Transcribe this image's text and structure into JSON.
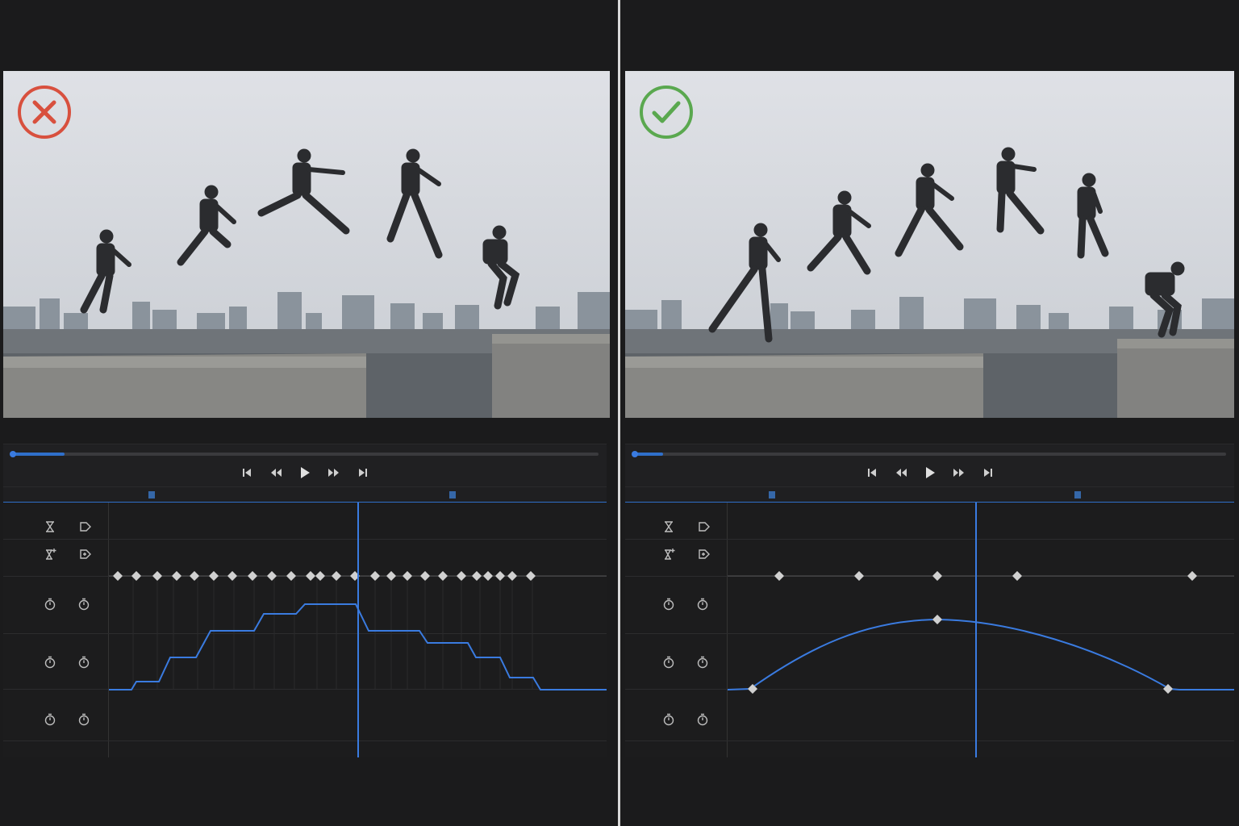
{
  "panels": [
    {
      "id": "left",
      "verdict": "incorrect",
      "verdict_icon": "x-circle-icon",
      "verdict_color": "#d8503e",
      "curve_style": "stepped",
      "playhead_position": 0.5,
      "playback_progress": 0.09
    },
    {
      "id": "right",
      "verdict": "correct",
      "verdict_icon": "check-circle-icon",
      "verdict_color": "#5aa84f",
      "curve_style": "smooth",
      "playhead_position": 0.49,
      "playback_progress": 0.05
    }
  ],
  "transport": {
    "buttons": [
      "skip-to-start-icon",
      "rewind-icon",
      "play-icon",
      "fast-forward-icon",
      "skip-to-end-icon"
    ]
  },
  "track_icons": [
    "hourglass-icon",
    "keyframe-tag-icon",
    "add-hourglass-icon",
    "add-keyframe-tag-icon",
    "stopwatch-icon",
    "stopwatch-icon"
  ],
  "colors": {
    "accent": "#2f6fca",
    "background": "#1b1b1c",
    "keyframe": "#d0d0d0",
    "error": "#d8503e",
    "success": "#5aa84f"
  }
}
